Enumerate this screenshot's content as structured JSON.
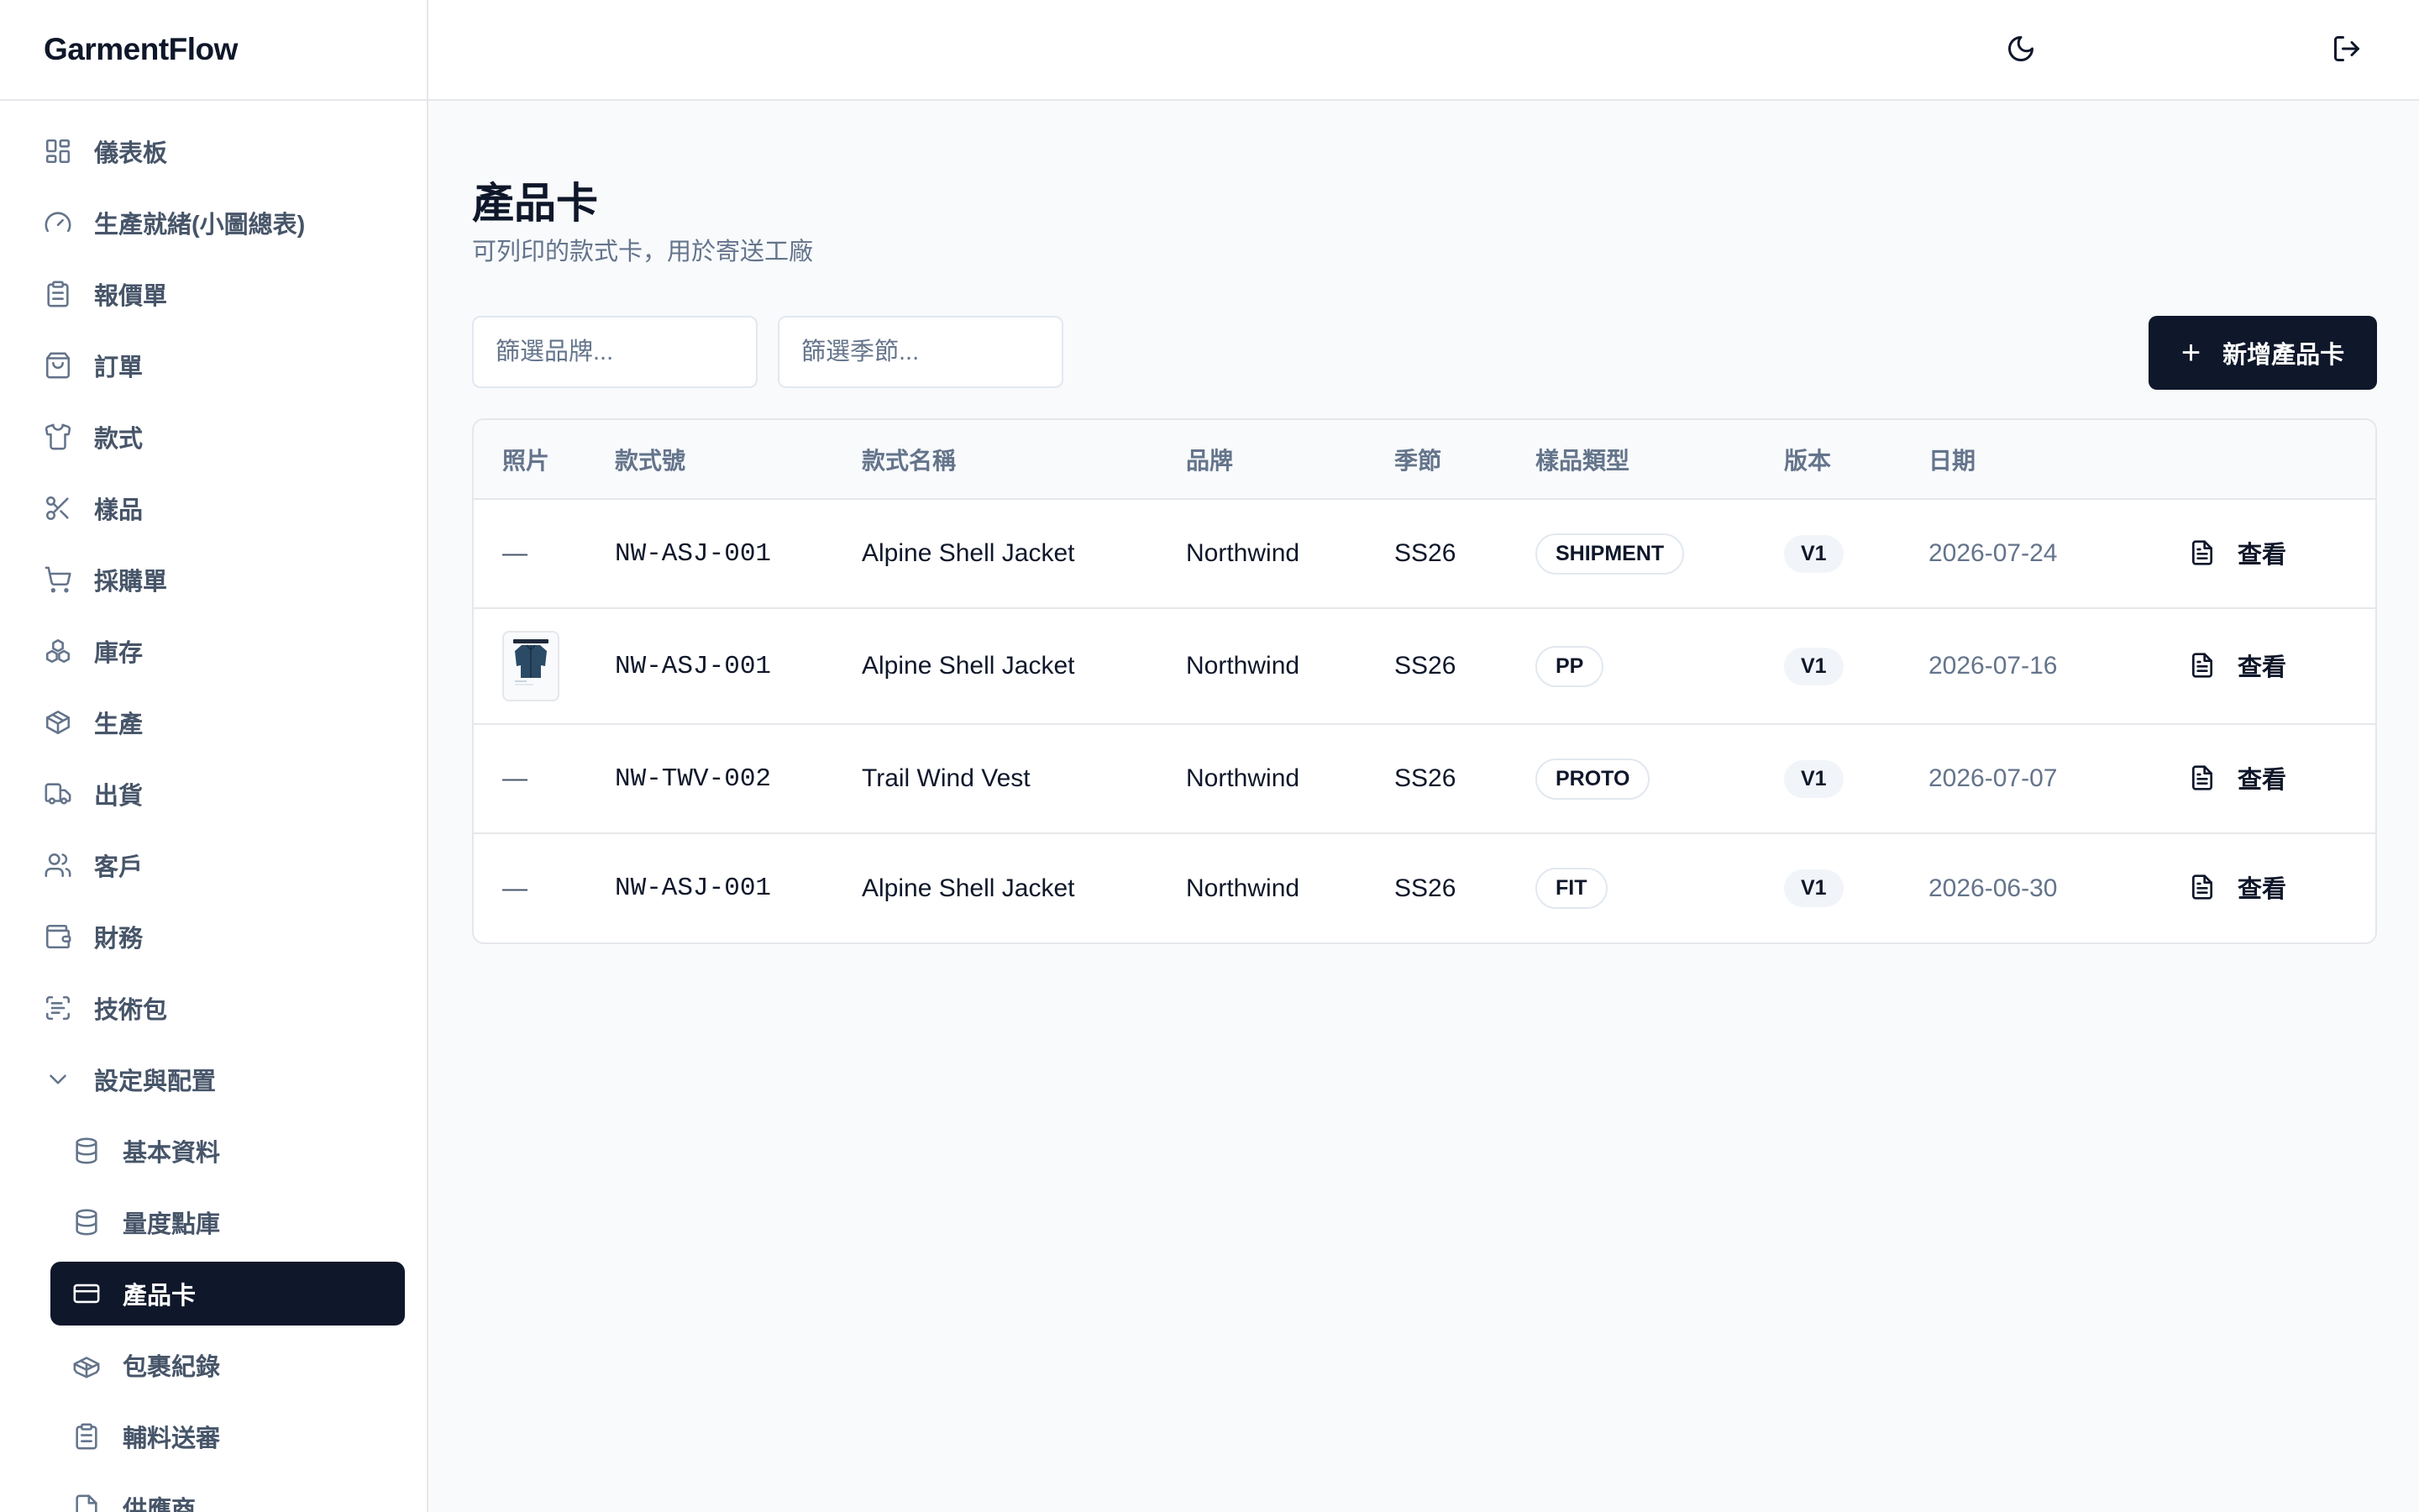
{
  "app": {
    "brand": "GarmentFlow"
  },
  "sidebar": {
    "items": [
      {
        "label": "儀表板",
        "icon": "dashboard-grid-icon"
      },
      {
        "label": "生產就緒(小圖總表)",
        "icon": "gauge-icon"
      },
      {
        "label": "報價單",
        "icon": "clipboard-icon"
      },
      {
        "label": "訂單",
        "icon": "shopping-bag-icon"
      },
      {
        "label": "款式",
        "icon": "shirt-icon"
      },
      {
        "label": "樣品",
        "icon": "scissors-icon"
      },
      {
        "label": "採購單",
        "icon": "cart-icon"
      },
      {
        "label": "庫存",
        "icon": "boxes-icon"
      },
      {
        "label": "生產",
        "icon": "package-icon"
      },
      {
        "label": "出貨",
        "icon": "truck-icon"
      },
      {
        "label": "客戶",
        "icon": "users-icon"
      },
      {
        "label": "財務",
        "icon": "wallet-icon"
      },
      {
        "label": "技術包",
        "icon": "scan-text-icon"
      },
      {
        "label": "設定與配置",
        "icon": "chevron-down-icon"
      }
    ],
    "sub_items": [
      {
        "label": "基本資料",
        "icon": "database-icon"
      },
      {
        "label": "量度點庫",
        "icon": "database-icon"
      },
      {
        "label": "產品卡",
        "icon": "card-icon",
        "active": true
      },
      {
        "label": "包裹紀錄",
        "icon": "package-open-icon"
      },
      {
        "label": "輔料送審",
        "icon": "clipboard-icon"
      },
      {
        "label": "供應商",
        "icon": "file-icon"
      }
    ]
  },
  "topbar": {
    "theme_icon": "moon-icon",
    "logout_icon": "logout-icon"
  },
  "page": {
    "title": "產品卡",
    "subtitle": "可列印的款式卡，用於寄送工廠",
    "filter_brand_placeholder": "篩選品牌...",
    "filter_season_placeholder": "篩選季節...",
    "new_button_label": "新增產品卡"
  },
  "table": {
    "headers": {
      "photo": "照片",
      "style_no": "款式號",
      "style_name": "款式名稱",
      "brand": "品牌",
      "season": "季節",
      "sample_type": "樣品類型",
      "version": "版本",
      "date": "日期"
    },
    "view_label": "查看",
    "rows": [
      {
        "photo": "—",
        "style_no": "NW-ASJ-001",
        "style_name": "Alpine Shell Jacket",
        "brand": "Northwind",
        "season": "SS26",
        "sample_type": "SHIPMENT",
        "version": "V1",
        "date": "2026-07-24"
      },
      {
        "photo": "",
        "style_no": "NW-ASJ-001",
        "style_name": "Alpine Shell Jacket",
        "brand": "Northwind",
        "season": "SS26",
        "sample_type": "PP",
        "version": "V1",
        "date": "2026-07-16"
      },
      {
        "photo": "—",
        "style_no": "NW-TWV-002",
        "style_name": "Trail Wind Vest",
        "brand": "Northwind",
        "season": "SS26",
        "sample_type": "PROTO",
        "version": "V1",
        "date": "2026-07-07"
      },
      {
        "photo": "—",
        "style_no": "NW-ASJ-001",
        "style_name": "Alpine Shell Jacket",
        "brand": "Northwind",
        "season": "SS26",
        "sample_type": "FIT",
        "version": "V1",
        "date": "2026-06-30"
      }
    ]
  }
}
